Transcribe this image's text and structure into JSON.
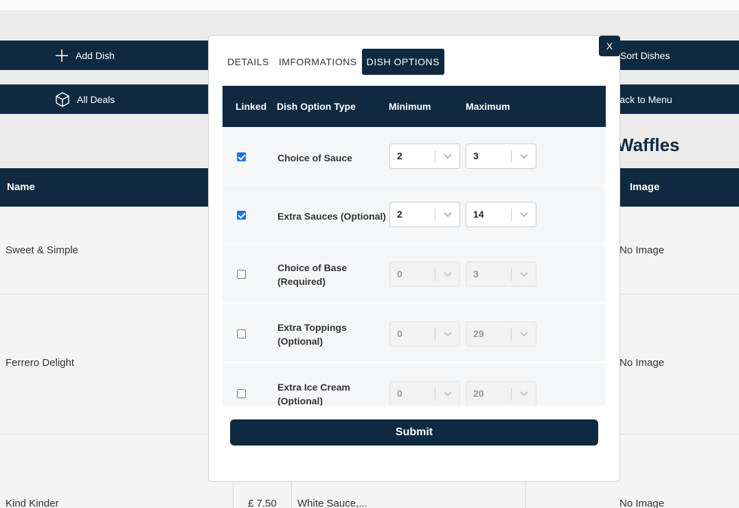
{
  "nav": {
    "add_dish": "Add Dish",
    "all_deals": "All Deals",
    "sort_dishes": "Sort Dishes",
    "back_to_menu": "Back to Menu"
  },
  "category_title": "Waffles",
  "table": {
    "columns": {
      "name": "Name",
      "image": "Image"
    },
    "rows": [
      {
        "name": "Sweet & Simple",
        "image": "No Image"
      },
      {
        "name": "Ferrero Delight",
        "image": "No Image"
      },
      {
        "name": "Kind Kinder",
        "price": "£ 7.50",
        "description": "White Sauce,...",
        "image": "No Image"
      }
    ]
  },
  "modal": {
    "close_label": "X",
    "tabs": [
      "DETAILS",
      "IMFORMATIONS",
      "DISH OPTIONS"
    ],
    "active_tab": "DISH OPTIONS",
    "columns": {
      "linked": "Linked",
      "type": "Dish Option Type",
      "min": "Minimum",
      "max": "Maximum"
    },
    "options": [
      {
        "linked": true,
        "type": "Choice of Sauce",
        "min": "2",
        "max": "3"
      },
      {
        "linked": true,
        "type": "Extra Sauces (Optional)",
        "min": "2",
        "max": "14"
      },
      {
        "linked": false,
        "type": "Choice of Base (Required)",
        "min": "0",
        "max": "3"
      },
      {
        "linked": false,
        "type": "Extra Toppings (Optional)",
        "min": "0",
        "max": "29"
      },
      {
        "linked": false,
        "type": "Extra Ice Cream (Optional)",
        "min": "0",
        "max": "20"
      }
    ],
    "submit_label": "Submit"
  },
  "colors": {
    "primary": "#0f2a40",
    "checkbox_checked": "#1a73e8"
  },
  "icons": {
    "add": "plus-icon",
    "deals": "box-icon",
    "select": "chevron-down-icon"
  }
}
